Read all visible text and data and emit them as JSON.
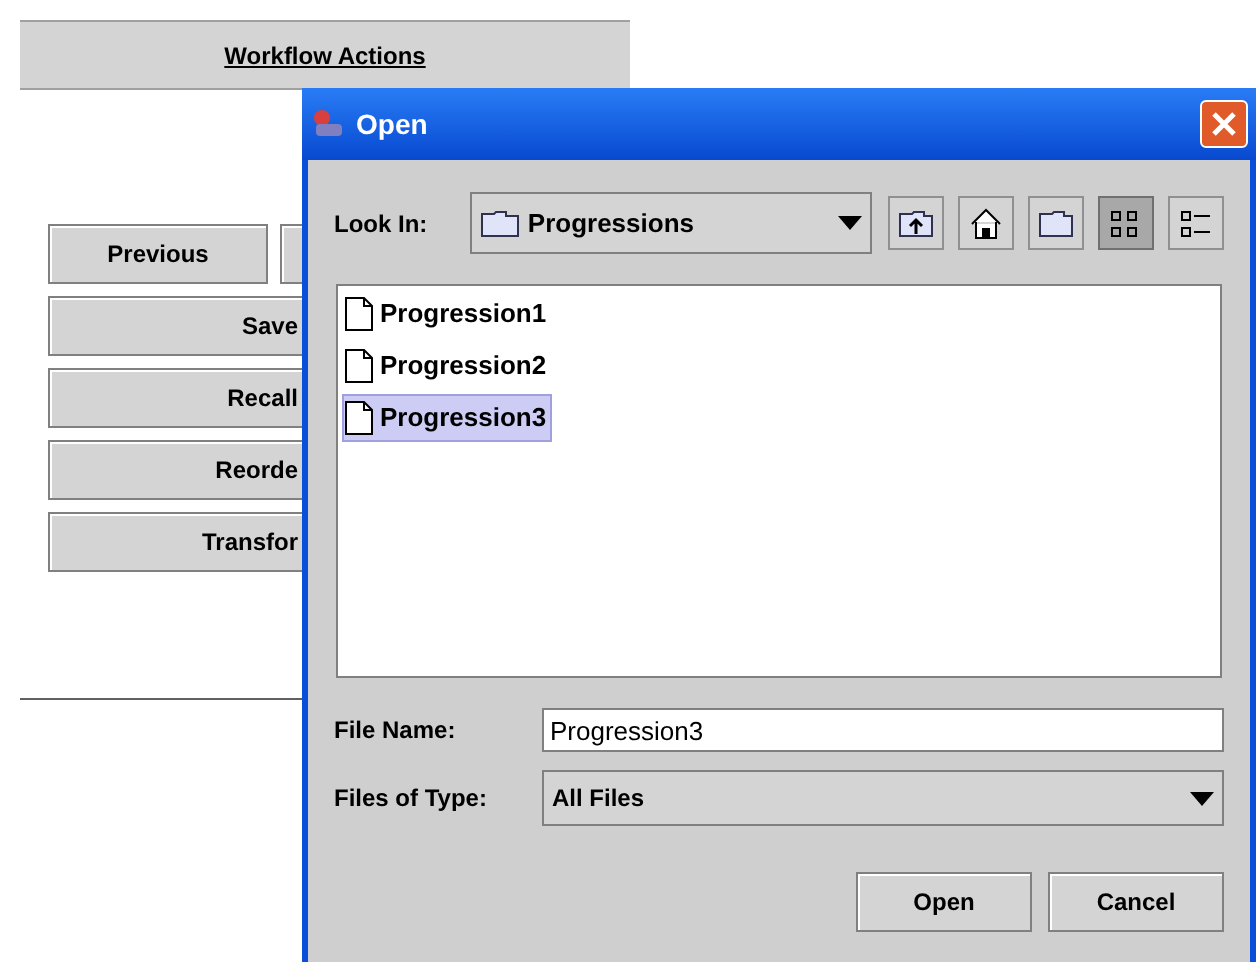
{
  "background_panel": {
    "header": "Workflow Actions",
    "buttons": [
      {
        "label": "Previous",
        "kind": "half"
      },
      {
        "kind": "half"
      },
      {
        "label": "Save",
        "kind": "full"
      },
      {
        "label": "Recall",
        "kind": "full"
      },
      {
        "label": "Reorde",
        "kind": "full"
      },
      {
        "label": "Transfor",
        "kind": "full"
      }
    ]
  },
  "dialog": {
    "title": "Open",
    "look_in": {
      "label": "Look In:",
      "value": "Progressions"
    },
    "toolbar": [
      {
        "kind": "up",
        "selected": false
      },
      {
        "kind": "home",
        "selected": false
      },
      {
        "kind": "new-folder",
        "selected": false
      },
      {
        "kind": "list",
        "selected": true
      },
      {
        "kind": "details",
        "selected": false
      }
    ],
    "files": [
      {
        "name": "Progression1",
        "selected": false
      },
      {
        "name": "Progression2",
        "selected": false
      },
      {
        "name": "Progression3",
        "selected": true
      }
    ],
    "file_name": {
      "label": "File Name:",
      "value": "Progression3"
    },
    "file_type": {
      "label": "Files of Type:",
      "value": "All Files"
    },
    "buttons": [
      "Open",
      "Cancel"
    ]
  }
}
